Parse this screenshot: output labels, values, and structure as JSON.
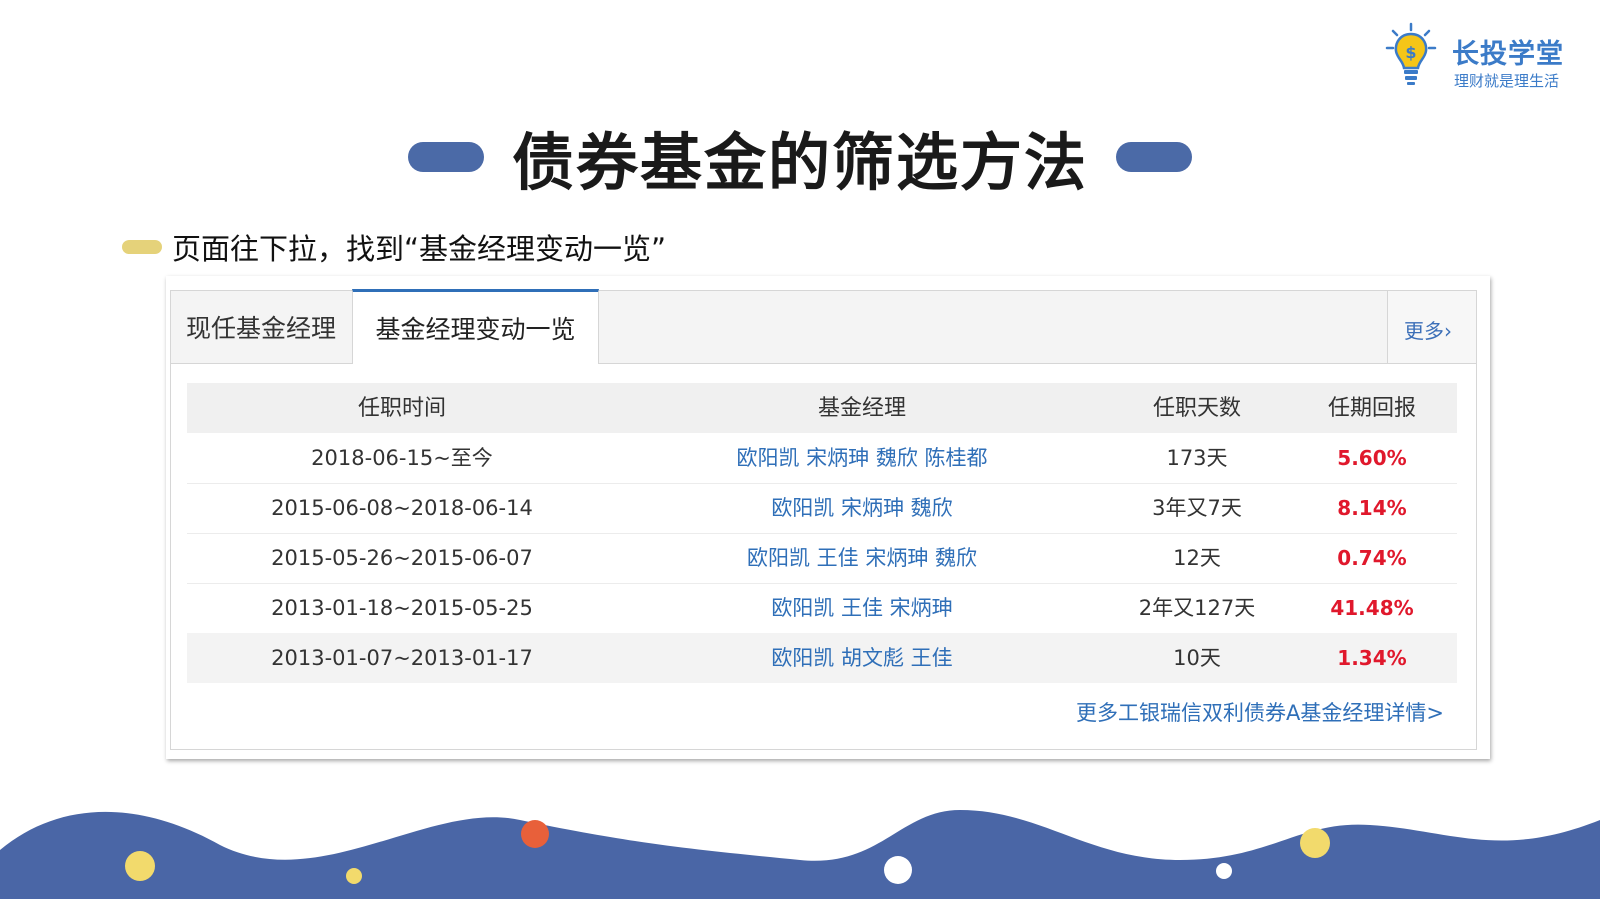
{
  "brand": {
    "title": "长投学堂",
    "slogan": "理财就是理生活"
  },
  "slide": {
    "title": "债券基金的筛选方法",
    "subtitle": "页面往下拉，找到“基金经理变动一览”"
  },
  "panel": {
    "tabs": [
      {
        "label": "现任基金经理"
      },
      {
        "label": "基金经理变动一览"
      }
    ],
    "more_label": "更多›",
    "columns": [
      "任职时间",
      "基金经理",
      "任职天数",
      "任期回报"
    ],
    "rows": [
      {
        "period": "2018-06-15~至今",
        "managers": "欧阳凯 宋炳珅 魏欣 陈桂都",
        "days": "173天",
        "return": "5.60%"
      },
      {
        "period": "2015-06-08~2018-06-14",
        "managers": "欧阳凯 宋炳珅 魏欣",
        "days": "3年又7天",
        "return": "8.14%"
      },
      {
        "period": "2015-05-26~2015-06-07",
        "managers": "欧阳凯 王佳 宋炳珅 魏欣",
        "days": "12天",
        "return": "0.74%"
      },
      {
        "period": "2013-01-18~2015-05-25",
        "managers": "欧阳凯 王佳 宋炳珅",
        "days": "2年又127天",
        "return": "41.48%"
      },
      {
        "period": "2013-01-07~2013-01-17",
        "managers": "欧阳凯 胡文彪 王佳",
        "days": "10天",
        "return": "1.34%"
      }
    ],
    "detail_link": "更多工银瑞信双利债券A基金经理详情>"
  },
  "colors": {
    "accent_blue": "#4b6aa7",
    "link_blue": "#2f6fb8",
    "return_red": "#e0182c",
    "accent_yellow": "#e5d27a",
    "dot_orange": "#e8603a"
  }
}
